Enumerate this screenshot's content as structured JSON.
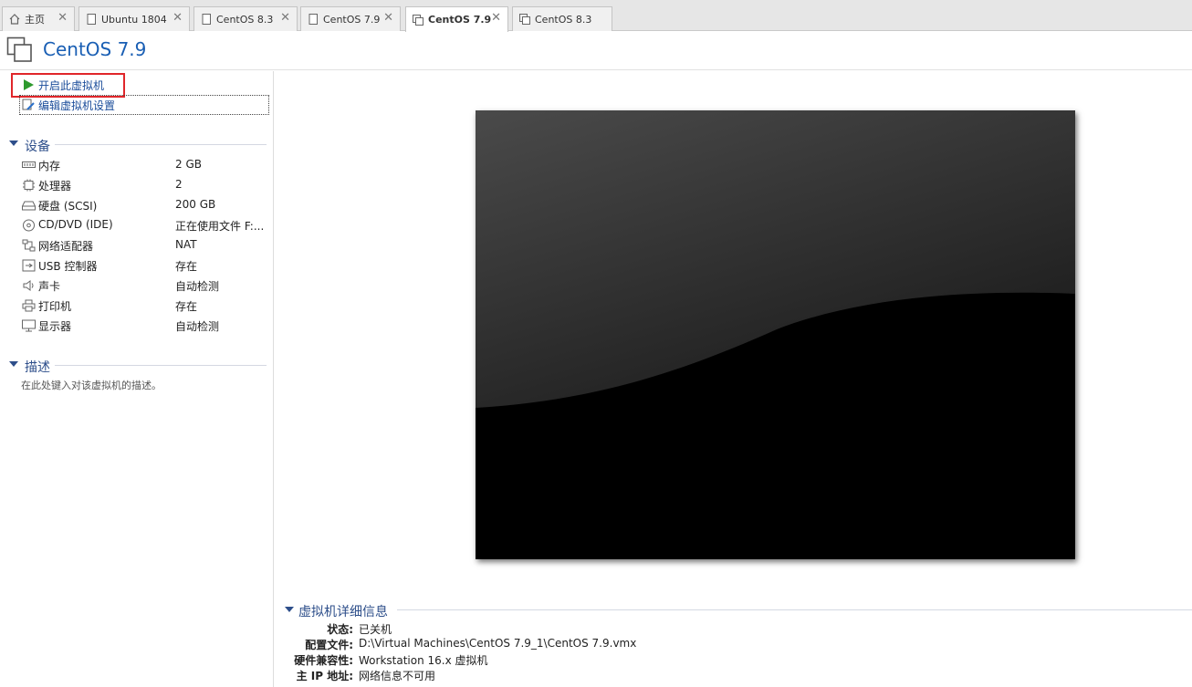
{
  "tabs": [
    {
      "label": "主页",
      "icon": "home-icon",
      "active": false
    },
    {
      "label": "Ubuntu 1804",
      "icon": "vm-page-icon",
      "active": false
    },
    {
      "label": "CentOS 8.3",
      "icon": "vm-page-icon",
      "active": false
    },
    {
      "label": "CentOS 7.9",
      "icon": "vm-page-icon",
      "active": false
    },
    {
      "label": "CentOS 7.9",
      "icon": "vm-stack-icon",
      "active": true
    },
    {
      "label": "CentOS 8.3",
      "icon": "vm-stack-icon",
      "active": false
    }
  ],
  "header": {
    "title": "CentOS 7.9"
  },
  "actions": {
    "power_on": "开启此虚拟机",
    "edit_settings": "编辑虚拟机设置"
  },
  "devices": {
    "title": "设备",
    "items": [
      {
        "icon": "memory-icon",
        "name": "内存",
        "value": "2 GB"
      },
      {
        "icon": "processor-icon",
        "name": "处理器",
        "value": "2"
      },
      {
        "icon": "harddisk-icon",
        "name": "硬盘 (SCSI)",
        "value": "200 GB"
      },
      {
        "icon": "cdrom-icon",
        "name": "CD/DVD (IDE)",
        "value": "正在使用文件 F:..."
      },
      {
        "icon": "network-icon",
        "name": "网络适配器",
        "value": "NAT"
      },
      {
        "icon": "usb-icon",
        "name": "USB 控制器",
        "value": "存在"
      },
      {
        "icon": "sound-icon",
        "name": "声卡",
        "value": "自动检测"
      },
      {
        "icon": "printer-icon",
        "name": "打印机",
        "value": "存在"
      },
      {
        "icon": "display-icon",
        "name": "显示器",
        "value": "自动检测"
      }
    ]
  },
  "description": {
    "title": "描述",
    "placeholder": "在此处键入对该虚拟机的描述。"
  },
  "details": {
    "title": "虚拟机详细信息",
    "rows": [
      {
        "label": "状态:",
        "value": "已关机"
      },
      {
        "label": "配置文件:",
        "value": "D:\\Virtual Machines\\CentOS 7.9_1\\CentOS 7.9.vmx"
      },
      {
        "label": "硬件兼容性:",
        "value": "Workstation 16.x 虚拟机"
      },
      {
        "label": "主 IP 地址:",
        "value": "网络信息不可用"
      }
    ]
  },
  "colors": {
    "accent": "#1a5fb4",
    "highlight": "#e0262a",
    "section": "#2d4e8a"
  }
}
